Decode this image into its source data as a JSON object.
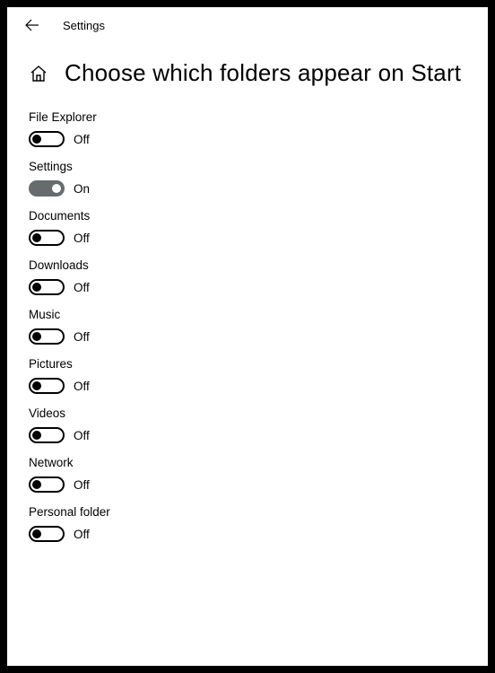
{
  "appTitle": "Settings",
  "pageTitle": "Choose which folders appear on Start",
  "stateLabels": {
    "on": "On",
    "off": "Off"
  },
  "items": [
    {
      "label": "File Explorer",
      "on": false,
      "slug": "file-explorer"
    },
    {
      "label": "Settings",
      "on": true,
      "slug": "settings"
    },
    {
      "label": "Documents",
      "on": false,
      "slug": "documents"
    },
    {
      "label": "Downloads",
      "on": false,
      "slug": "downloads"
    },
    {
      "label": "Music",
      "on": false,
      "slug": "music"
    },
    {
      "label": "Pictures",
      "on": false,
      "slug": "pictures"
    },
    {
      "label": "Videos",
      "on": false,
      "slug": "videos"
    },
    {
      "label": "Network",
      "on": false,
      "slug": "network"
    },
    {
      "label": "Personal folder",
      "on": false,
      "slug": "personal-folder"
    }
  ]
}
